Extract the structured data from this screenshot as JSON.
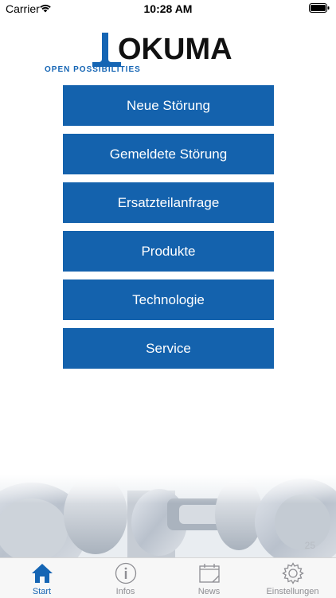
{
  "status_bar": {
    "carrier": "Carrier",
    "time": "10:28 AM"
  },
  "logo": {
    "text": "OKUMA",
    "tagline": "OPEN POSSIBILITIES",
    "color": "#1565b4"
  },
  "menu": {
    "items": [
      {
        "label": "Neue Störung"
      },
      {
        "label": "Gemeldete Störung"
      },
      {
        "label": "Ersatzteilanfrage"
      },
      {
        "label": "Produkte"
      },
      {
        "label": "Technologie"
      },
      {
        "label": "Service"
      }
    ],
    "button_color": "#1462ad"
  },
  "version": "25",
  "tab_bar": {
    "tabs": [
      {
        "label": "Start",
        "icon": "home-icon",
        "active": true
      },
      {
        "label": "Infos",
        "icon": "info-icon",
        "active": false
      },
      {
        "label": "News",
        "icon": "news-icon",
        "active": false
      },
      {
        "label": "Einstellungen",
        "icon": "gear-icon",
        "active": false
      }
    ],
    "active_color": "#1565b4",
    "inactive_color": "#8e8e93"
  }
}
